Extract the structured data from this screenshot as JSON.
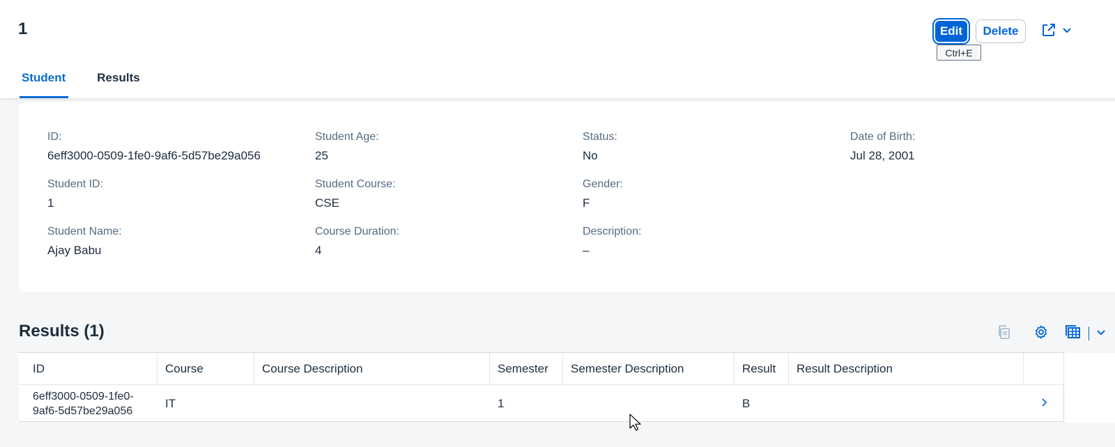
{
  "header": {
    "title": "1",
    "edit_label": "Edit",
    "delete_label": "Delete",
    "tooltip": "Ctrl+E"
  },
  "tabs": [
    {
      "label": "Student",
      "active": true
    },
    {
      "label": "Results",
      "active": false
    }
  ],
  "student": {
    "id_label": "ID:",
    "id_value": "6eff3000-0509-1fe0-9af6-5d57be29a056",
    "student_id_label": "Student ID:",
    "student_id_value": "1",
    "name_label": "Student Name:",
    "name_value": "Ajay Babu",
    "age_label": "Student Age:",
    "age_value": "25",
    "course_label": "Student Course:",
    "course_value": "CSE",
    "duration_label": "Course Duration:",
    "duration_value": "4",
    "status_label": "Status:",
    "status_value": "No",
    "gender_label": "Gender:",
    "gender_value": "F",
    "description_label": "Description:",
    "description_value": "–",
    "dob_label": "Date of Birth:",
    "dob_value": "Jul 28, 2001"
  },
  "results": {
    "title": "Results (1)",
    "columns": [
      "ID",
      "Course",
      "Course Description",
      "Semester",
      "Semester Description",
      "Result",
      "Result Description"
    ],
    "rows": [
      {
        "id_line1": "6eff3000-0509-1fe0-",
        "id_line2": "9af6-5d57be29a056",
        "course": "IT",
        "course_description": "",
        "semester": "1",
        "semester_description": "",
        "result": "B",
        "result_description": ""
      }
    ]
  },
  "colors": {
    "accent": "#0a6ed1",
    "button_primary": "#0064d9",
    "text": "#1d2d3e",
    "label": "#556b82"
  }
}
